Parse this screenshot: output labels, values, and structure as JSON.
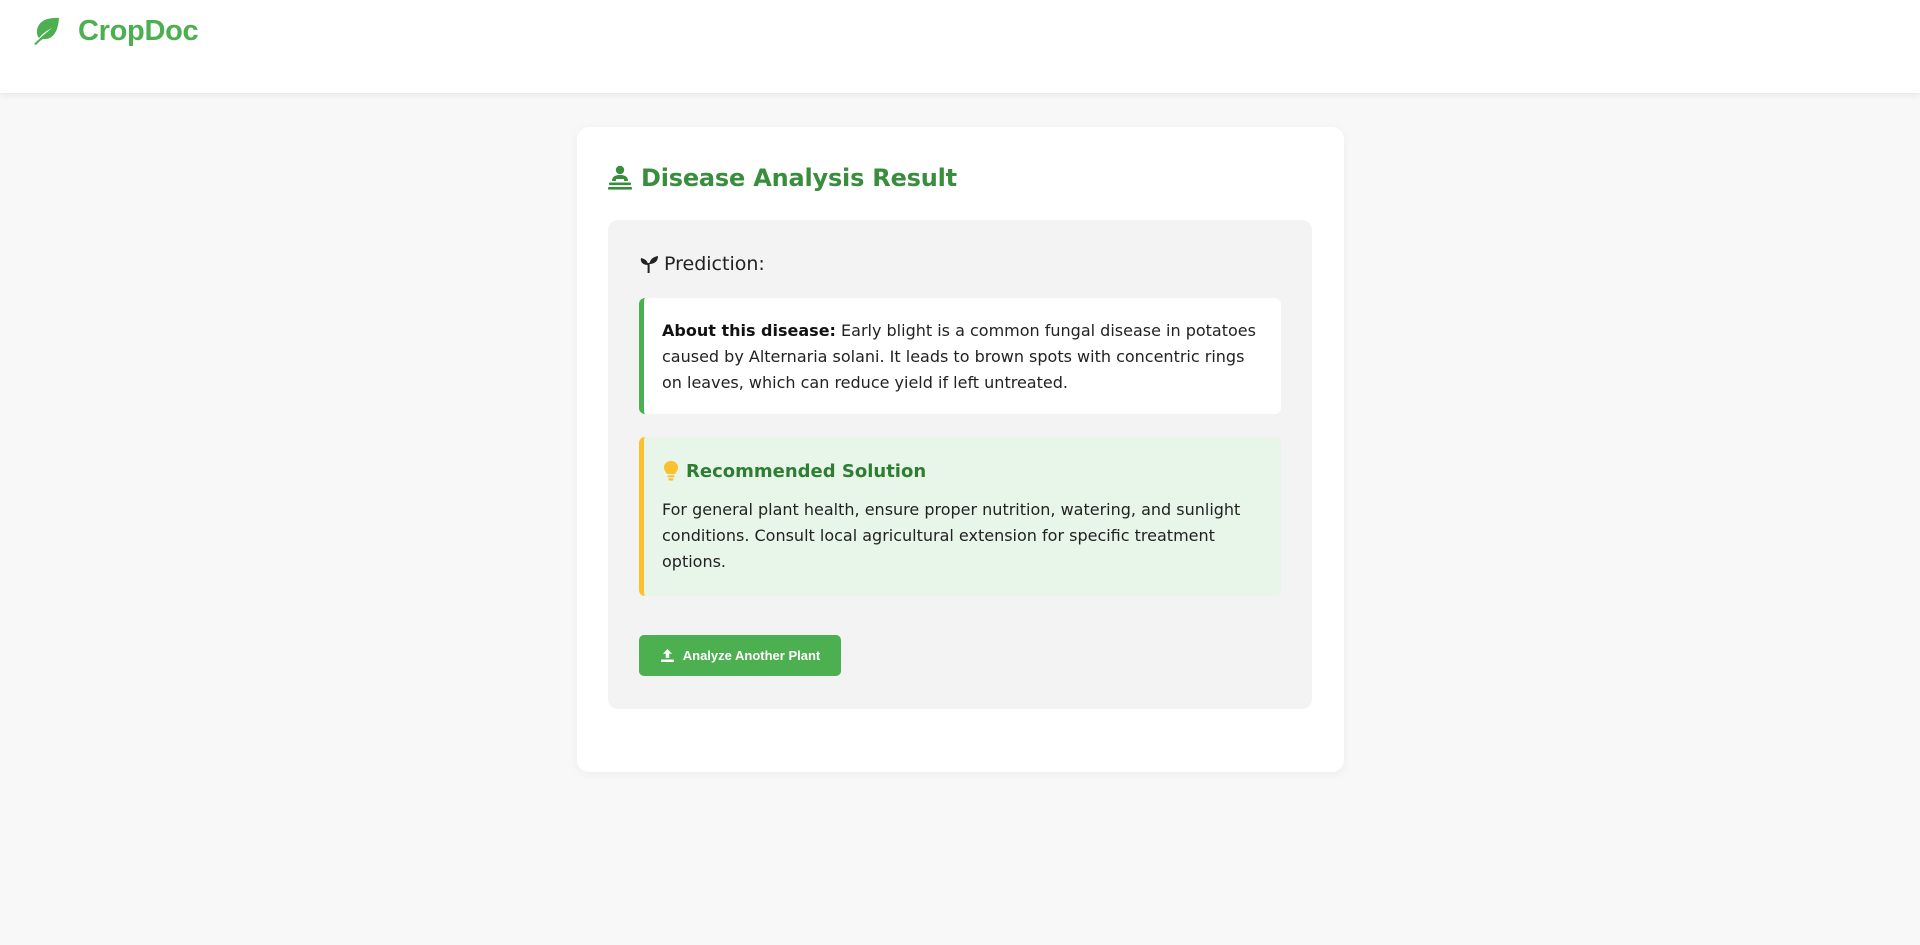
{
  "app": {
    "name": "CropDoc",
    "logo_icon": "leaf-icon",
    "brand_color": "#4caf50"
  },
  "result_card": {
    "title": "Disease Analysis Result",
    "title_icon": "diagnoses-icon",
    "title_color": "#388e3c",
    "prediction": {
      "label": "Prediction:",
      "icon": "seedling-icon"
    },
    "about": {
      "label": "About this disease:",
      "text": "Early blight is a common fungal disease in potatoes caused by Alternaria solani. It leads to brown spots with concentric rings on leaves, which can reduce yield if left untreated.",
      "accent_color": "#4caf50"
    },
    "solution": {
      "heading": "Recommended Solution",
      "icon": "lightbulb-icon",
      "text": "For general plant health, ensure proper nutrition, watering, and sunlight conditions. Consult local agricultural extension for specific treatment options.",
      "accent_color": "#fbc02d",
      "background": "#e8f5e9"
    },
    "action": {
      "label": "Analyze Another Plant",
      "icon": "upload-icon"
    }
  }
}
